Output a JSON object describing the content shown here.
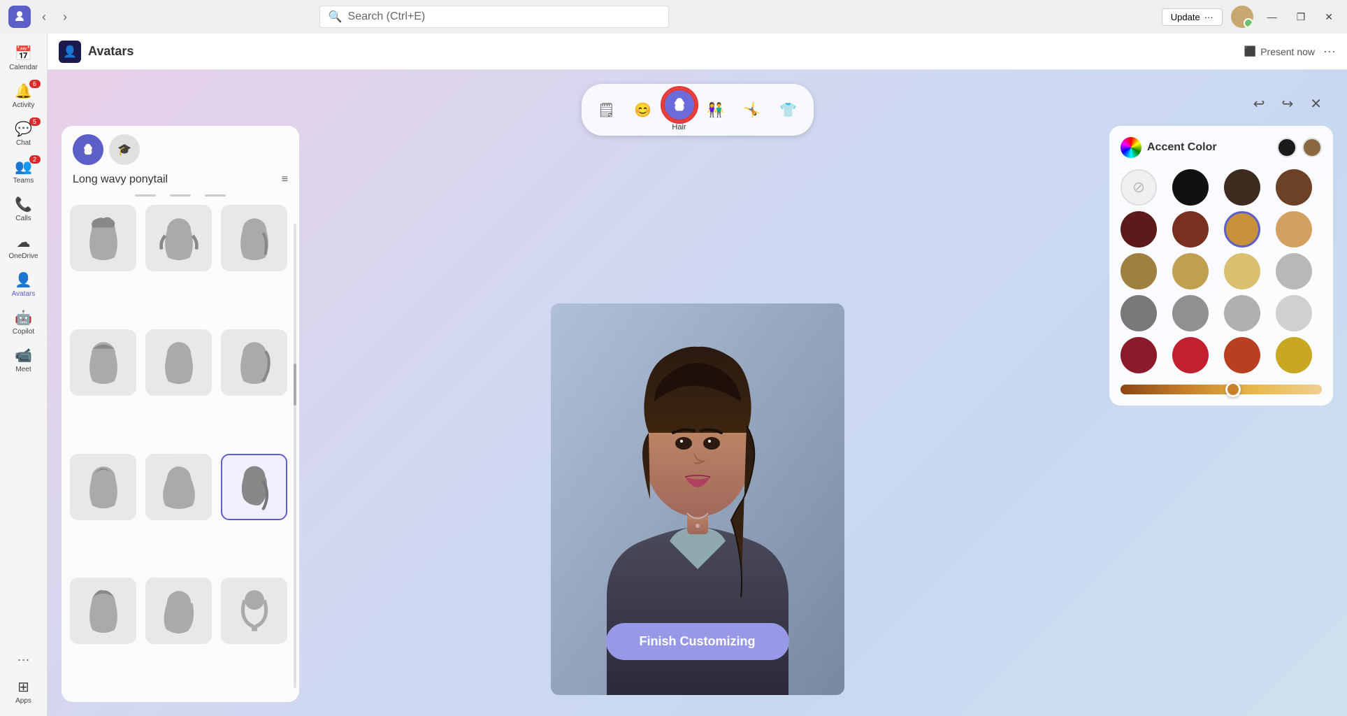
{
  "titleBar": {
    "searchPlaceholder": "Search (Ctrl+E)",
    "updateLabel": "Update",
    "updateMore": "···",
    "minimizeBtn": "—",
    "maximizeBtn": "❐",
    "closeBtn": "✕"
  },
  "sidebar": {
    "items": [
      {
        "id": "calendar",
        "label": "Calendar",
        "icon": "📅",
        "badge": null,
        "active": false
      },
      {
        "id": "activity",
        "label": "Activity",
        "icon": "🔔",
        "badge": "6",
        "active": false
      },
      {
        "id": "chat",
        "label": "Chat",
        "icon": "💬",
        "badge": "5",
        "active": false
      },
      {
        "id": "teams",
        "label": "Teams",
        "icon": "👥",
        "badge": "2",
        "active": false
      },
      {
        "id": "calls",
        "label": "Calls",
        "icon": "📞",
        "badge": null,
        "active": false
      },
      {
        "id": "onedrive",
        "label": "OneDrive",
        "icon": "☁",
        "badge": null,
        "active": false
      },
      {
        "id": "avatars",
        "label": "Avatars",
        "icon": "👤",
        "badge": null,
        "active": true
      },
      {
        "id": "copilot",
        "label": "Copilot",
        "icon": "🤖",
        "badge": null,
        "active": false
      },
      {
        "id": "meet",
        "label": "Meet",
        "icon": "📹",
        "badge": null,
        "active": false
      }
    ],
    "bottomItems": [
      {
        "id": "more",
        "label": "···",
        "icon": "···"
      },
      {
        "id": "apps",
        "label": "Apps",
        "icon": "⊞"
      }
    ]
  },
  "appHeader": {
    "appIconText": "A",
    "title": "Avatars",
    "presentNowLabel": "Present now",
    "moreIcon": "···"
  },
  "categoryToolbar": {
    "categories": [
      {
        "id": "preset",
        "icon": "🗒",
        "label": ""
      },
      {
        "id": "face",
        "icon": "😊",
        "label": ""
      },
      {
        "id": "hair",
        "icon": "👤",
        "label": "Hair",
        "active": true
      },
      {
        "id": "group",
        "icon": "👫",
        "label": ""
      },
      {
        "id": "body",
        "icon": "🤸",
        "label": ""
      },
      {
        "id": "outfit",
        "icon": "👕",
        "label": ""
      }
    ]
  },
  "actionRow": {
    "undoIcon": "↩",
    "redoIcon": "↪",
    "closeIcon": "✕"
  },
  "leftPanel": {
    "tabs": [
      {
        "id": "hair-style",
        "icon": "👤",
        "active": true
      },
      {
        "id": "accessory",
        "icon": "🎓",
        "active": false
      }
    ],
    "title": "Long wavy ponytail",
    "filterIcon": "≡",
    "hairStyles": [
      {
        "id": 1,
        "selected": false
      },
      {
        "id": 2,
        "selected": false
      },
      {
        "id": 3,
        "selected": false
      },
      {
        "id": 4,
        "selected": false
      },
      {
        "id": 5,
        "selected": false
      },
      {
        "id": 6,
        "selected": false
      },
      {
        "id": 7,
        "selected": false
      },
      {
        "id": 8,
        "selected": false
      },
      {
        "id": 9,
        "selected": true
      },
      {
        "id": 10,
        "selected": false
      },
      {
        "id": 11,
        "selected": false
      },
      {
        "id": 12,
        "selected": false
      }
    ]
  },
  "rightPanel": {
    "title": "Accent Color",
    "selectedColors": [
      "#1a1a1a",
      "#8B6940"
    ],
    "colors": [
      {
        "id": "none",
        "value": "none",
        "label": "No color"
      },
      {
        "id": "black",
        "value": "#111111"
      },
      {
        "id": "darkbrown",
        "value": "#3d2b1f"
      },
      {
        "id": "brown",
        "value": "#6b4226"
      },
      {
        "id": "darkred",
        "value": "#5c1a1a"
      },
      {
        "id": "redbrown",
        "value": "#7a3020"
      },
      {
        "id": "tan",
        "value": "#c8913a",
        "selected": true
      },
      {
        "id": "sandybrown",
        "value": "#d4a060"
      },
      {
        "id": "khaki1",
        "value": "#a08040"
      },
      {
        "id": "khaki2",
        "value": "#c0a050"
      },
      {
        "id": "khaki3",
        "value": "#d8c070"
      },
      {
        "id": "silver1",
        "value": "#b8b8b8"
      },
      {
        "id": "gray1",
        "value": "#787878"
      },
      {
        "id": "gray2",
        "value": "#909090"
      },
      {
        "id": "gray3",
        "value": "#b0b0b0"
      },
      {
        "id": "lightgray",
        "value": "#d0d0d0"
      },
      {
        "id": "red1",
        "value": "#8b1a2a"
      },
      {
        "id": "red2",
        "value": "#c02030"
      },
      {
        "id": "red3",
        "value": "#b84020"
      },
      {
        "id": "gold",
        "value": "#c8a820"
      }
    ],
    "sliderValue": 52
  },
  "finishBtn": {
    "label": "Finish Customizing"
  }
}
